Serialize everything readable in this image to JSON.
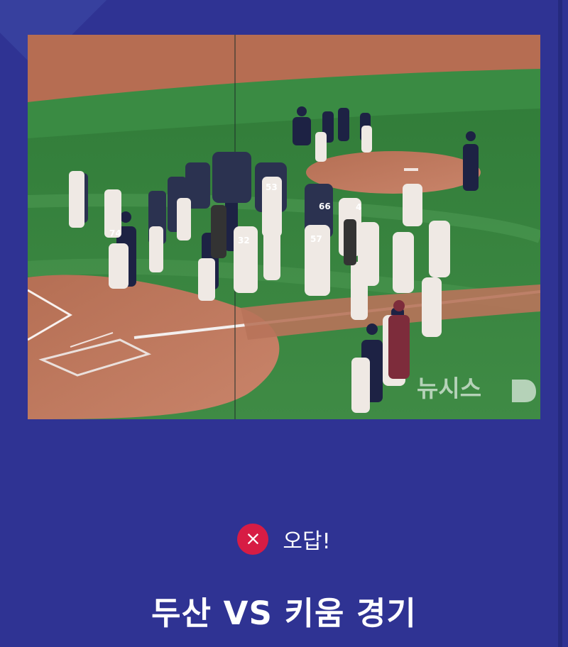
{
  "photo": {
    "watermark": "뉴시스",
    "jersey_numbers": [
      "74",
      "32",
      "57",
      "53",
      "66",
      "4"
    ]
  },
  "result": {
    "icon": "close-icon",
    "label": "오답!"
  },
  "question": {
    "title": "두산 VS 키움 경기"
  },
  "colors": {
    "background": "#2f3393",
    "wrong_badge": "#d71c44",
    "text": "#ffffff"
  }
}
